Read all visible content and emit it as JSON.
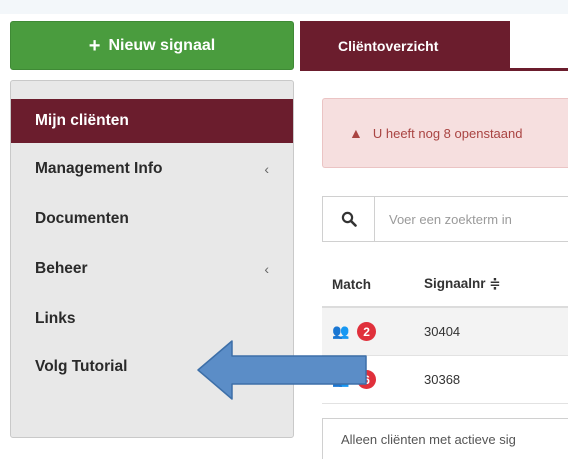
{
  "actions": {
    "new_signal_label": "Nieuw signaal",
    "plus_symbol": "+"
  },
  "sidebar": {
    "items": [
      {
        "label": "Mijn cliënten",
        "active": true,
        "has_submenu": false
      },
      {
        "label": "Management Info",
        "active": false,
        "has_submenu": true
      },
      {
        "label": "Documenten",
        "active": false,
        "has_submenu": false
      },
      {
        "label": "Beheer",
        "active": false,
        "has_submenu": true
      },
      {
        "label": "Links",
        "active": false,
        "has_submenu": false
      },
      {
        "label": "Volg Tutorial",
        "active": false,
        "has_submenu": false
      }
    ],
    "chevron_symbol": "‹"
  },
  "tabs": [
    {
      "label": "Cliëntoverzicht",
      "active": true
    }
  ],
  "alert": {
    "icon": "warning-icon",
    "text": "U heeft nog 8 openstaand"
  },
  "search": {
    "icon": "search-icon",
    "placeholder": "Voer een zoekterm in"
  },
  "table": {
    "headers": {
      "match": "Match",
      "signaalnr": "Signaalnr ≑"
    },
    "rows": [
      {
        "match_icon": "people-icon",
        "match_count": "2",
        "signaalnr": "30404"
      },
      {
        "match_icon": "people-icon",
        "match_count": "6",
        "signaalnr": "30368"
      }
    ]
  },
  "filter": {
    "label": "Alleen cliënten met actieve sig"
  },
  "colors": {
    "brand": "#6b1d2d",
    "success": "#4a9c3e",
    "danger": "#e0303b",
    "alert_bg": "#f6dfdf",
    "annotation_arrow": "#5b8dc7"
  }
}
